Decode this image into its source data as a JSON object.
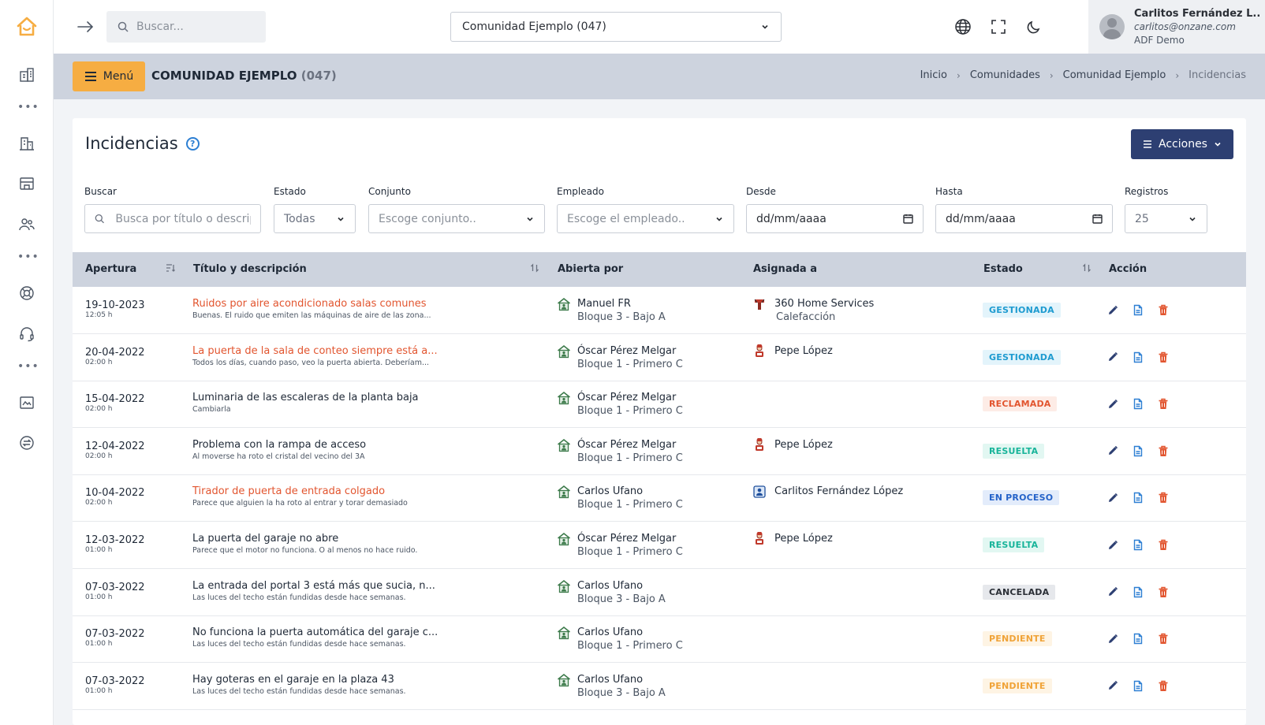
{
  "topbar": {
    "search_placeholder": "Buscar...",
    "community_selected": "Comunidad Ejemplo (047)",
    "user": {
      "name": "Carlitos Fernández L..",
      "email": "carlitos@onzane.com",
      "org": "ADF Demo"
    }
  },
  "subheader": {
    "menu_label": "Menú",
    "community_name": "COMUNIDAD EJEMPLO",
    "community_code": "(047)",
    "breadcrumb": [
      "Inicio",
      "Comunidades",
      "Comunidad Ejemplo",
      "Incidencias"
    ]
  },
  "page": {
    "title": "Incidencias",
    "actions_label": "Acciones"
  },
  "filters": {
    "search": {
      "label": "Buscar",
      "placeholder": "Busca por título o descripción"
    },
    "estado": {
      "label": "Estado",
      "value": "Todas"
    },
    "conjunto": {
      "label": "Conjunto",
      "placeholder": "Escoge conjunto.."
    },
    "empleado": {
      "label": "Empleado",
      "placeholder": "Escoge el empleado.."
    },
    "desde": {
      "label": "Desde",
      "value": "dd/mm/aaaa"
    },
    "hasta": {
      "label": "Hasta",
      "value": "dd/mm/aaaa"
    },
    "registros": {
      "label": "Registros",
      "value": "25"
    }
  },
  "table": {
    "headers": {
      "apertura": "Apertura",
      "titulo": "Título y descripción",
      "abierta": "Abierta por",
      "asignada": "Asignada a",
      "estado": "Estado",
      "accion": "Acción"
    },
    "rows": [
      {
        "date": "19-10-2023",
        "time": "12:05 h",
        "title": "Ruidos por aire acondicionado salas comunes",
        "desc": "Buenas. El ruido que emiten las máquinas de aire de las zona...",
        "alert": true,
        "opened_name": "Manuel FR",
        "opened_loc": "Bloque 3 - Bajo A",
        "assigned_name": "360 Home Services",
        "assigned_sub": "Calefacción",
        "assigned_icon": "company-icon",
        "status": "GESTIONADA",
        "status_key": "gestionada"
      },
      {
        "date": "20-04-2022",
        "time": "02:00 h",
        "title": "La puerta de la sala de conteo siempre está a...",
        "desc": "Todos los días, cuando paso, veo la puerta abierta. Deberíam...",
        "alert": true,
        "opened_name": "Óscar Pérez Melgar",
        "opened_loc": "Bloque 1 - Primero C",
        "assigned_name": "Pepe López",
        "assigned_sub": "",
        "assigned_icon": "worker-icon",
        "status": "GESTIONADA",
        "status_key": "gestionada"
      },
      {
        "date": "15-04-2022",
        "time": "02:00 h",
        "title": "Luminaria de las escaleras de la planta baja",
        "desc": "Cambiarla",
        "alert": false,
        "opened_name": "Óscar Pérez Melgar",
        "opened_loc": "Bloque 1 - Primero C",
        "assigned_name": "",
        "assigned_sub": "",
        "assigned_icon": "",
        "status": "RECLAMADA",
        "status_key": "reclamada"
      },
      {
        "date": "12-04-2022",
        "time": "02:00 h",
        "title": "Problema con la rampa de acceso",
        "desc": "Al moverse ha roto el cristal del vecino del 3A",
        "alert": false,
        "opened_name": "Óscar Pérez Melgar",
        "opened_loc": "Bloque 1 - Primero C",
        "assigned_name": "Pepe López",
        "assigned_sub": "",
        "assigned_icon": "worker-icon",
        "status": "RESUELTA",
        "status_key": "resuelta"
      },
      {
        "date": "10-04-2022",
        "time": "02:00 h",
        "title": "Tirador de puerta de entrada colgado",
        "desc": "Parece que alguien la ha roto al entrar y torar demasiado",
        "alert": true,
        "opened_name": "Carlos Ufano",
        "opened_loc": "Bloque 1 - Primero C",
        "assigned_name": "Carlitos Fernández López",
        "assigned_sub": "",
        "assigned_icon": "admin-icon",
        "status": "EN PROCESO",
        "status_key": "proceso"
      },
      {
        "date": "12-03-2022",
        "time": "01:00 h",
        "title": "La puerta del garaje no abre",
        "desc": "Parece que el motor no funciona. O al menos no hace ruido.",
        "alert": false,
        "opened_name": "Óscar Pérez Melgar",
        "opened_loc": "Bloque 1 - Primero C",
        "assigned_name": "Pepe López",
        "assigned_sub": "",
        "assigned_icon": "worker-icon",
        "status": "RESUELTA",
        "status_key": "resuelta"
      },
      {
        "date": "07-03-2022",
        "time": "01:00 h",
        "title": "La entrada del portal 3 está más que sucia, n...",
        "desc": "Las luces del techo están fundidas desde hace semanas.",
        "alert": false,
        "opened_name": "Carlos Ufano",
        "opened_loc": "Bloque 3 - Bajo A",
        "assigned_name": "",
        "assigned_sub": "",
        "assigned_icon": "",
        "status": "CANCELADA",
        "status_key": "cancelada"
      },
      {
        "date": "07-03-2022",
        "time": "01:00 h",
        "title": "No funciona la puerta automática del garaje c...",
        "desc": "Las luces del techo están fundidas desde hace semanas.",
        "alert": false,
        "opened_name": "Carlos Ufano",
        "opened_loc": "Bloque 1 - Primero C",
        "assigned_name": "",
        "assigned_sub": "",
        "assigned_icon": "",
        "status": "PENDIENTE",
        "status_key": "pendiente"
      },
      {
        "date": "07-03-2022",
        "time": "01:00 h",
        "title": "Hay goteras en el garaje en la plaza 43",
        "desc": "Las luces del techo están fundidas desde hace semanas.",
        "alert": false,
        "opened_name": "Carlos Ufano",
        "opened_loc": "Bloque 3 - Bajo A",
        "assigned_name": "",
        "assigned_sub": "",
        "assigned_icon": "",
        "status": "PENDIENTE",
        "status_key": "pendiente"
      }
    ]
  },
  "colors": {
    "accent_orange": "#f6ad42",
    "primary_navy": "#2d3f72",
    "alert_text": "#e2552f",
    "status": {
      "gestionada": {
        "fg": "#1e9bd0",
        "bg": "#e3f4fb"
      },
      "reclamada": {
        "fg": "#e2552f",
        "bg": "#fdece6"
      },
      "resuelta": {
        "fg": "#18b49a",
        "bg": "#e2f7f2"
      },
      "proceso": {
        "fg": "#2563c9",
        "bg": "#e3ecfb"
      },
      "cancelada": {
        "fg": "#2b2f36",
        "bg": "#e6e8ec"
      },
      "pendiente": {
        "fg": "#f0a338",
        "bg": "#fef4e4"
      }
    }
  }
}
